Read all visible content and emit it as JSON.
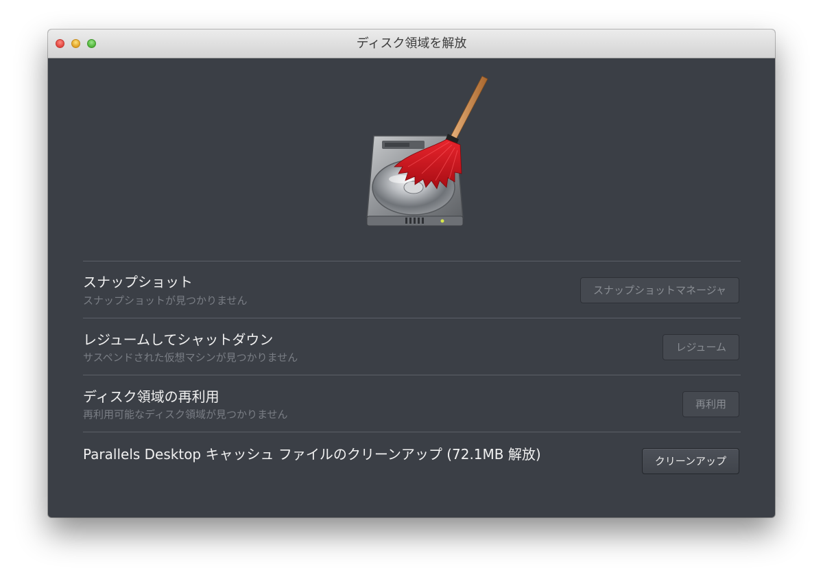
{
  "window": {
    "title": "ディスク領域を解放"
  },
  "colors": {
    "window_bg": "#3b3f46",
    "broom_red": "#d0141c"
  },
  "hero": {
    "icon": "hard-drive-broom-icon"
  },
  "rows": [
    {
      "title": "スナップショット",
      "subtitle": "スナップショットが見つかりません",
      "button": "スナップショットマネージャ",
      "button_enabled": false
    },
    {
      "title": "レジュームしてシャットダウン",
      "subtitle": "サスペンドされた仮想マシンが見つかりません",
      "button": "レジューム",
      "button_enabled": false
    },
    {
      "title": "ディスク領域の再利用",
      "subtitle": "再利用可能なディスク領域が見つかりません",
      "button": "再利用",
      "button_enabled": false
    },
    {
      "title": "Parallels Desktop キャッシュ ファイルのクリーンアップ (72.1MB 解放)",
      "button": "クリーンアップ",
      "button_enabled": true
    }
  ]
}
